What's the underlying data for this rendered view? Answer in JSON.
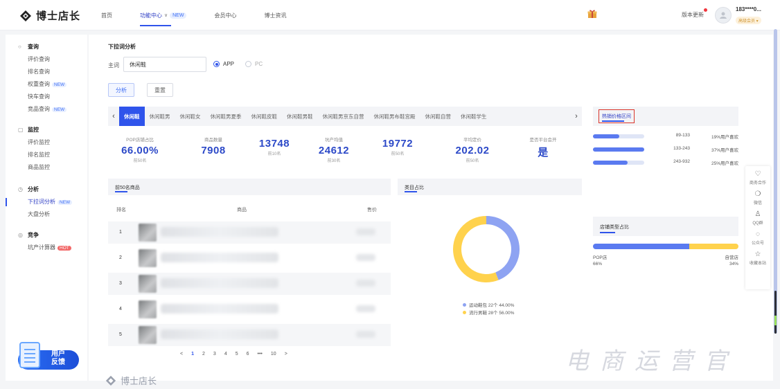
{
  "header": {
    "logo_text": "博士店长",
    "nav": [
      {
        "label": "首页",
        "active": false
      },
      {
        "label": "功能中心",
        "active": true,
        "badge": "NEW",
        "has_chevron": true
      },
      {
        "label": "会员中心",
        "active": false
      },
      {
        "label": "博士资讯",
        "active": false
      }
    ],
    "version_label": "版本更新",
    "user_phone": "183****0...",
    "user_badge": "高级会员 ▾"
  },
  "sidebar": {
    "groups": [
      {
        "title": "查询",
        "icon": "search-icon",
        "items": [
          {
            "label": "评价查询"
          },
          {
            "label": "排名查询"
          },
          {
            "label": "权重查询",
            "badge": "NEW"
          },
          {
            "label": "快车查询"
          },
          {
            "label": "竞品查询",
            "badge": "NEW"
          }
        ]
      },
      {
        "title": "监控",
        "icon": "monitor-icon",
        "items": [
          {
            "label": "评价监控"
          },
          {
            "label": "排名监控"
          },
          {
            "label": "商品监控"
          }
        ]
      },
      {
        "title": "分析",
        "icon": "clock-icon",
        "items": [
          {
            "label": "下拉词分析",
            "badge": "NEW",
            "active": true
          },
          {
            "label": "大盘分析"
          }
        ]
      },
      {
        "title": "竞争",
        "icon": "target-icon",
        "items": [
          {
            "label": "坑产计算器",
            "badge": "HOT",
            "hot": true
          }
        ]
      }
    ],
    "feedback_line1": "用户",
    "feedback_line2": "反馈"
  },
  "main": {
    "title": "下拉词分析",
    "keyword_label": "主词",
    "keyword_value": "休闲鞋",
    "platform_options": [
      {
        "label": "APP",
        "selected": true
      },
      {
        "label": "PC",
        "selected": false
      }
    ],
    "analyze_label": "分析",
    "reset_label": "重置",
    "keyword_tabs": [
      "休闲鞋",
      "休闲鞋男",
      "休闲鞋女",
      "休闲鞋男夏季",
      "休闲鞋皮鞋",
      "休闲鞋男鞋",
      "休闲鞋男京东自营",
      "休闲鞋男布鞋宫殿",
      "休闲鞋自营",
      "休闲鞋学生"
    ],
    "stats": [
      {
        "label": "POP店铺占比",
        "value": "66.00%",
        "sub": "前50名"
      },
      {
        "label": "商品数量",
        "value": "7908",
        "sub": ""
      },
      {
        "label": "",
        "value": "13748",
        "sub": "前10名"
      },
      {
        "label": "坑产均值",
        "value": "24612",
        "sub": "前30名"
      },
      {
        "label": "",
        "value": "19772",
        "sub": "前50名"
      },
      {
        "label": "平均定价",
        "value": "202.02",
        "sub": "前50名"
      },
      {
        "label": "是否平台会开",
        "value": "是",
        "sub": ""
      }
    ],
    "top50_title": "前50名商品",
    "category_title": "类目占比",
    "table_headers": {
      "rank": "排名",
      "product": "商品",
      "price": "售价"
    },
    "rows": [
      {
        "rank": "1"
      },
      {
        "rank": "2"
      },
      {
        "rank": "3"
      },
      {
        "rank": "4"
      },
      {
        "rank": "5"
      }
    ],
    "pager": {
      "prev": "<",
      "pages": [
        "1",
        "2",
        "3",
        "4",
        "5",
        "6",
        "•••",
        "10"
      ],
      "next": ">",
      "current": "1"
    },
    "footer_logo": "博士店长"
  },
  "category_chart": {
    "legend": [
      {
        "label": "运动鞋包 22个 44.00%",
        "color": "#8ea3f2"
      },
      {
        "label": "流行男鞋 28个 56.00%",
        "color": "#ffd24d"
      }
    ]
  },
  "chart_data": [
    {
      "type": "pie",
      "title": "类目占比",
      "categories": [
        "运动鞋包",
        "流行男鞋"
      ],
      "values": [
        44.0,
        56.0
      ],
      "counts": [
        22,
        28
      ],
      "colors": [
        "#8ea3f2",
        "#ffd24d"
      ]
    },
    {
      "type": "bar",
      "title": "热销价格区间",
      "categories": [
        "89-133",
        "133-243",
        "243-932"
      ],
      "values": [
        19,
        37,
        25
      ],
      "labels": [
        "19%用户喜欢",
        "37%用户喜欢",
        "25%用户喜欢"
      ]
    },
    {
      "type": "bar",
      "title": "店铺类型占比",
      "categories": [
        "POP店",
        "自营店"
      ],
      "values": [
        66,
        34
      ],
      "labels": [
        "66%",
        "34%"
      ],
      "colors": [
        "#5a7af0",
        "#ffd24d"
      ]
    }
  ],
  "tools": [
    {
      "label": "商务合作",
      "icon": "handshake-icon"
    },
    {
      "label": "微信",
      "icon": "wechat-icon"
    },
    {
      "label": "QQ群",
      "icon": "qq-icon"
    },
    {
      "label": "公众号",
      "icon": "chat-icon"
    },
    {
      "label": "收藏本站",
      "icon": "star-icon"
    }
  ],
  "watermark": "电商运营官"
}
